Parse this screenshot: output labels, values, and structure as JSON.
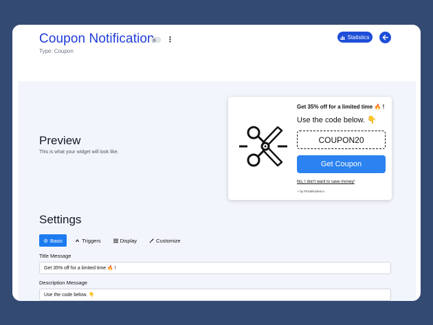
{
  "header": {
    "title": "Coupon Notification",
    "subtitle": "Type: Coupon",
    "statistics_label": "Statistics",
    "more_icon": "kebab-icon",
    "back_icon": "arrow-left-icon"
  },
  "preview": {
    "heading": "Preview",
    "description": "This is what your widget will look like."
  },
  "widget": {
    "title": "Get 35% off for a limited time 🔥 !",
    "description": "Use the code below. 👇",
    "code": "COUPON20",
    "button_label": "Get Coupon",
    "decline_label": "No, I don't want to save money!",
    "by_label": "by FlockRocket.io",
    "icon": "scissors-icon"
  },
  "settings": {
    "heading": "Settings",
    "tabs": [
      {
        "label": "Basic",
        "icon": "gear-icon",
        "active": true
      },
      {
        "label": "Triggers",
        "icon": "chevron-up-icon",
        "active": false
      },
      {
        "label": "Display",
        "icon": "list-icon",
        "active": false
      },
      {
        "label": "Customize",
        "icon": "brush-icon",
        "active": false
      }
    ],
    "fields": [
      {
        "label": "Title Message",
        "value": "Get 35% off for a limited time 🔥 !"
      },
      {
        "label": "Description Message",
        "value": "Use the code below. 👇"
      }
    ]
  },
  "colors": {
    "background": "#334a73",
    "accent": "#1d4ed8",
    "button": "#2b82f0",
    "content_bg": "#f3f5fc"
  }
}
